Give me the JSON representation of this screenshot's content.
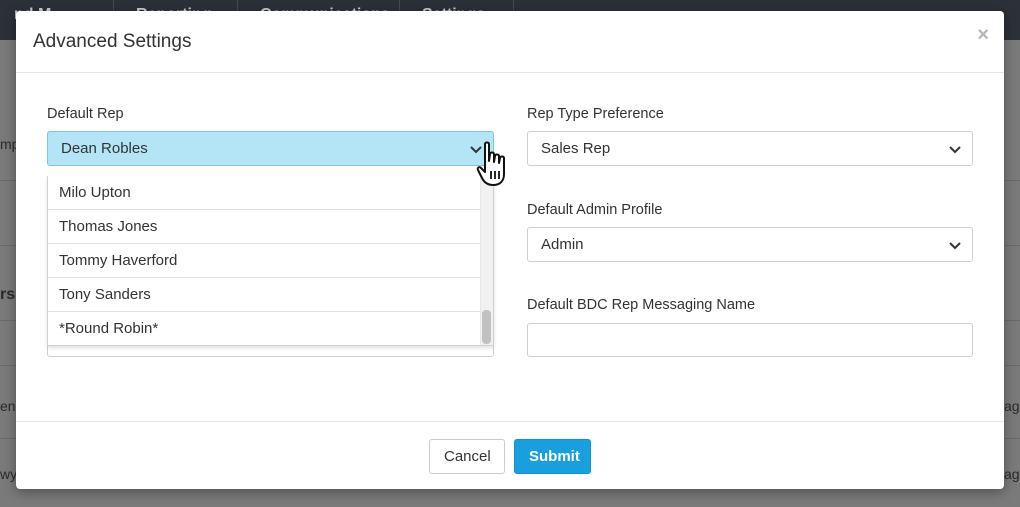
{
  "background": {
    "tabs": [
      "nd M",
      "Reporting",
      "Communications",
      "Settings"
    ],
    "fragments": [
      "mp",
      "rs",
      "en",
      "wyc",
      "ag",
      "ag"
    ]
  },
  "modal": {
    "title": "Advanced Settings",
    "close_label": "×",
    "default_rep": {
      "label": "Default Rep",
      "selected": "Dean Robles",
      "options": [
        "Milo Upton",
        "Thomas Jones",
        "Tommy Haverford",
        "Tony Sanders",
        "*Round Robin*"
      ]
    },
    "rep_type_preference": {
      "label": "Rep Type Preference",
      "selected": "Sales Rep"
    },
    "default_admin_profile": {
      "label": "Default Admin Profile",
      "selected": "Admin"
    },
    "default_bdc_messaging_name": {
      "label": "Default BDC Rep Messaging Name",
      "value": ""
    },
    "footer": {
      "cancel_label": "Cancel",
      "submit_label": "Submit"
    }
  },
  "colors": {
    "accent": "#1a9fde",
    "open_select_bg": "#b4e5f7"
  },
  "icons": [
    "chevron-down-icon",
    "close-icon",
    "hand-pointer-cursor"
  ]
}
